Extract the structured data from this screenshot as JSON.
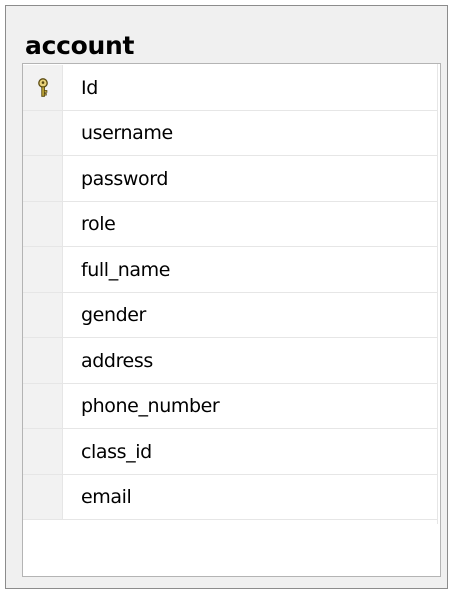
{
  "table": {
    "name": "account",
    "columns": [
      {
        "name": "Id",
        "primary_key": true,
        "icon": "key-icon"
      },
      {
        "name": "username",
        "primary_key": false
      },
      {
        "name": "password",
        "primary_key": false
      },
      {
        "name": "role",
        "primary_key": false
      },
      {
        "name": "full_name",
        "primary_key": false
      },
      {
        "name": "gender",
        "primary_key": false
      },
      {
        "name": "address",
        "primary_key": false
      },
      {
        "name": "phone_number",
        "primary_key": false
      },
      {
        "name": "class_id",
        "primary_key": false
      },
      {
        "name": "email",
        "primary_key": false
      }
    ]
  },
  "colors": {
    "key_icon": "#c9b03c",
    "border": "#8c8c8c",
    "frame": "#f0f0f0"
  }
}
